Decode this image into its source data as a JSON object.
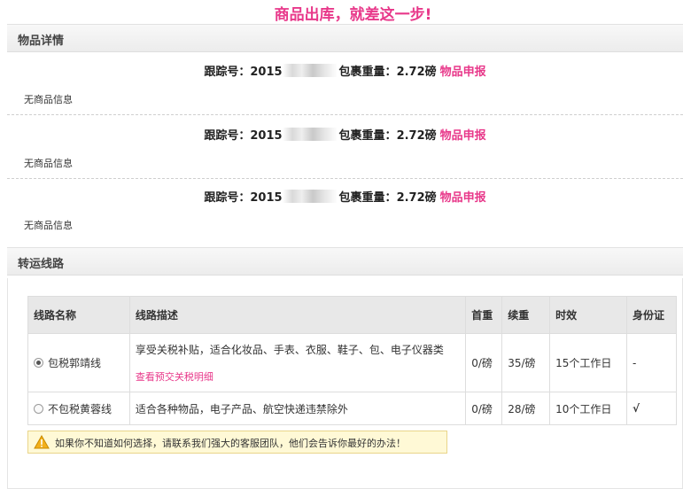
{
  "page_title": "商品出库，就差这一步!",
  "details_section": {
    "title": "物品详情"
  },
  "packages": [
    {
      "tracking_label": "跟踪号：",
      "tracking_visible": "2015",
      "weight_label": "包裹重量：",
      "weight_value": "2.72磅",
      "declare_link": "物品申报",
      "no_goods": "无商品信息"
    },
    {
      "tracking_label": "跟踪号：",
      "tracking_visible": "2015",
      "weight_label": "包裹重量：",
      "weight_value": "2.72磅",
      "declare_link": "物品申报",
      "no_goods": "无商品信息"
    },
    {
      "tracking_label": "跟踪号：",
      "tracking_visible": "2015",
      "weight_label": "包裹重量：",
      "weight_value": "2.72磅",
      "declare_link": "物品申报",
      "no_goods": "无商品信息"
    }
  ],
  "route_section": {
    "title": "转运线路"
  },
  "route_table": {
    "headers": [
      "线路名称",
      "线路描述",
      "首重",
      "续重",
      "时效",
      "身份证"
    ],
    "rows": [
      {
        "name": "包税郭靖线",
        "selected": true,
        "description": "享受关税补贴，适合化妆品、手表、衣服、鞋子、包、电子仪器类",
        "tax_link": "查看预交关税明细",
        "first_weight": "0/磅",
        "extra_weight": "35/磅",
        "timing": "15个工作日",
        "id_card": "-"
      },
      {
        "name": "不包税黄蓉线",
        "selected": false,
        "description": "适合各种物品，电子产品、航空快递违禁除外",
        "tax_link": "",
        "first_weight": "0/磅",
        "extra_weight": "28/磅",
        "timing": "10个工作日",
        "id_card": "√"
      }
    ]
  },
  "notice": {
    "icon": "warning-icon",
    "text": "如果你不知道如何选择，请联系我们强大的客服团队，他们会告诉你最好的办法！"
  },
  "colors": {
    "accent": "#e8388a",
    "header_bg": "#e8e8e8",
    "notice_bg": "#fff9d6"
  }
}
